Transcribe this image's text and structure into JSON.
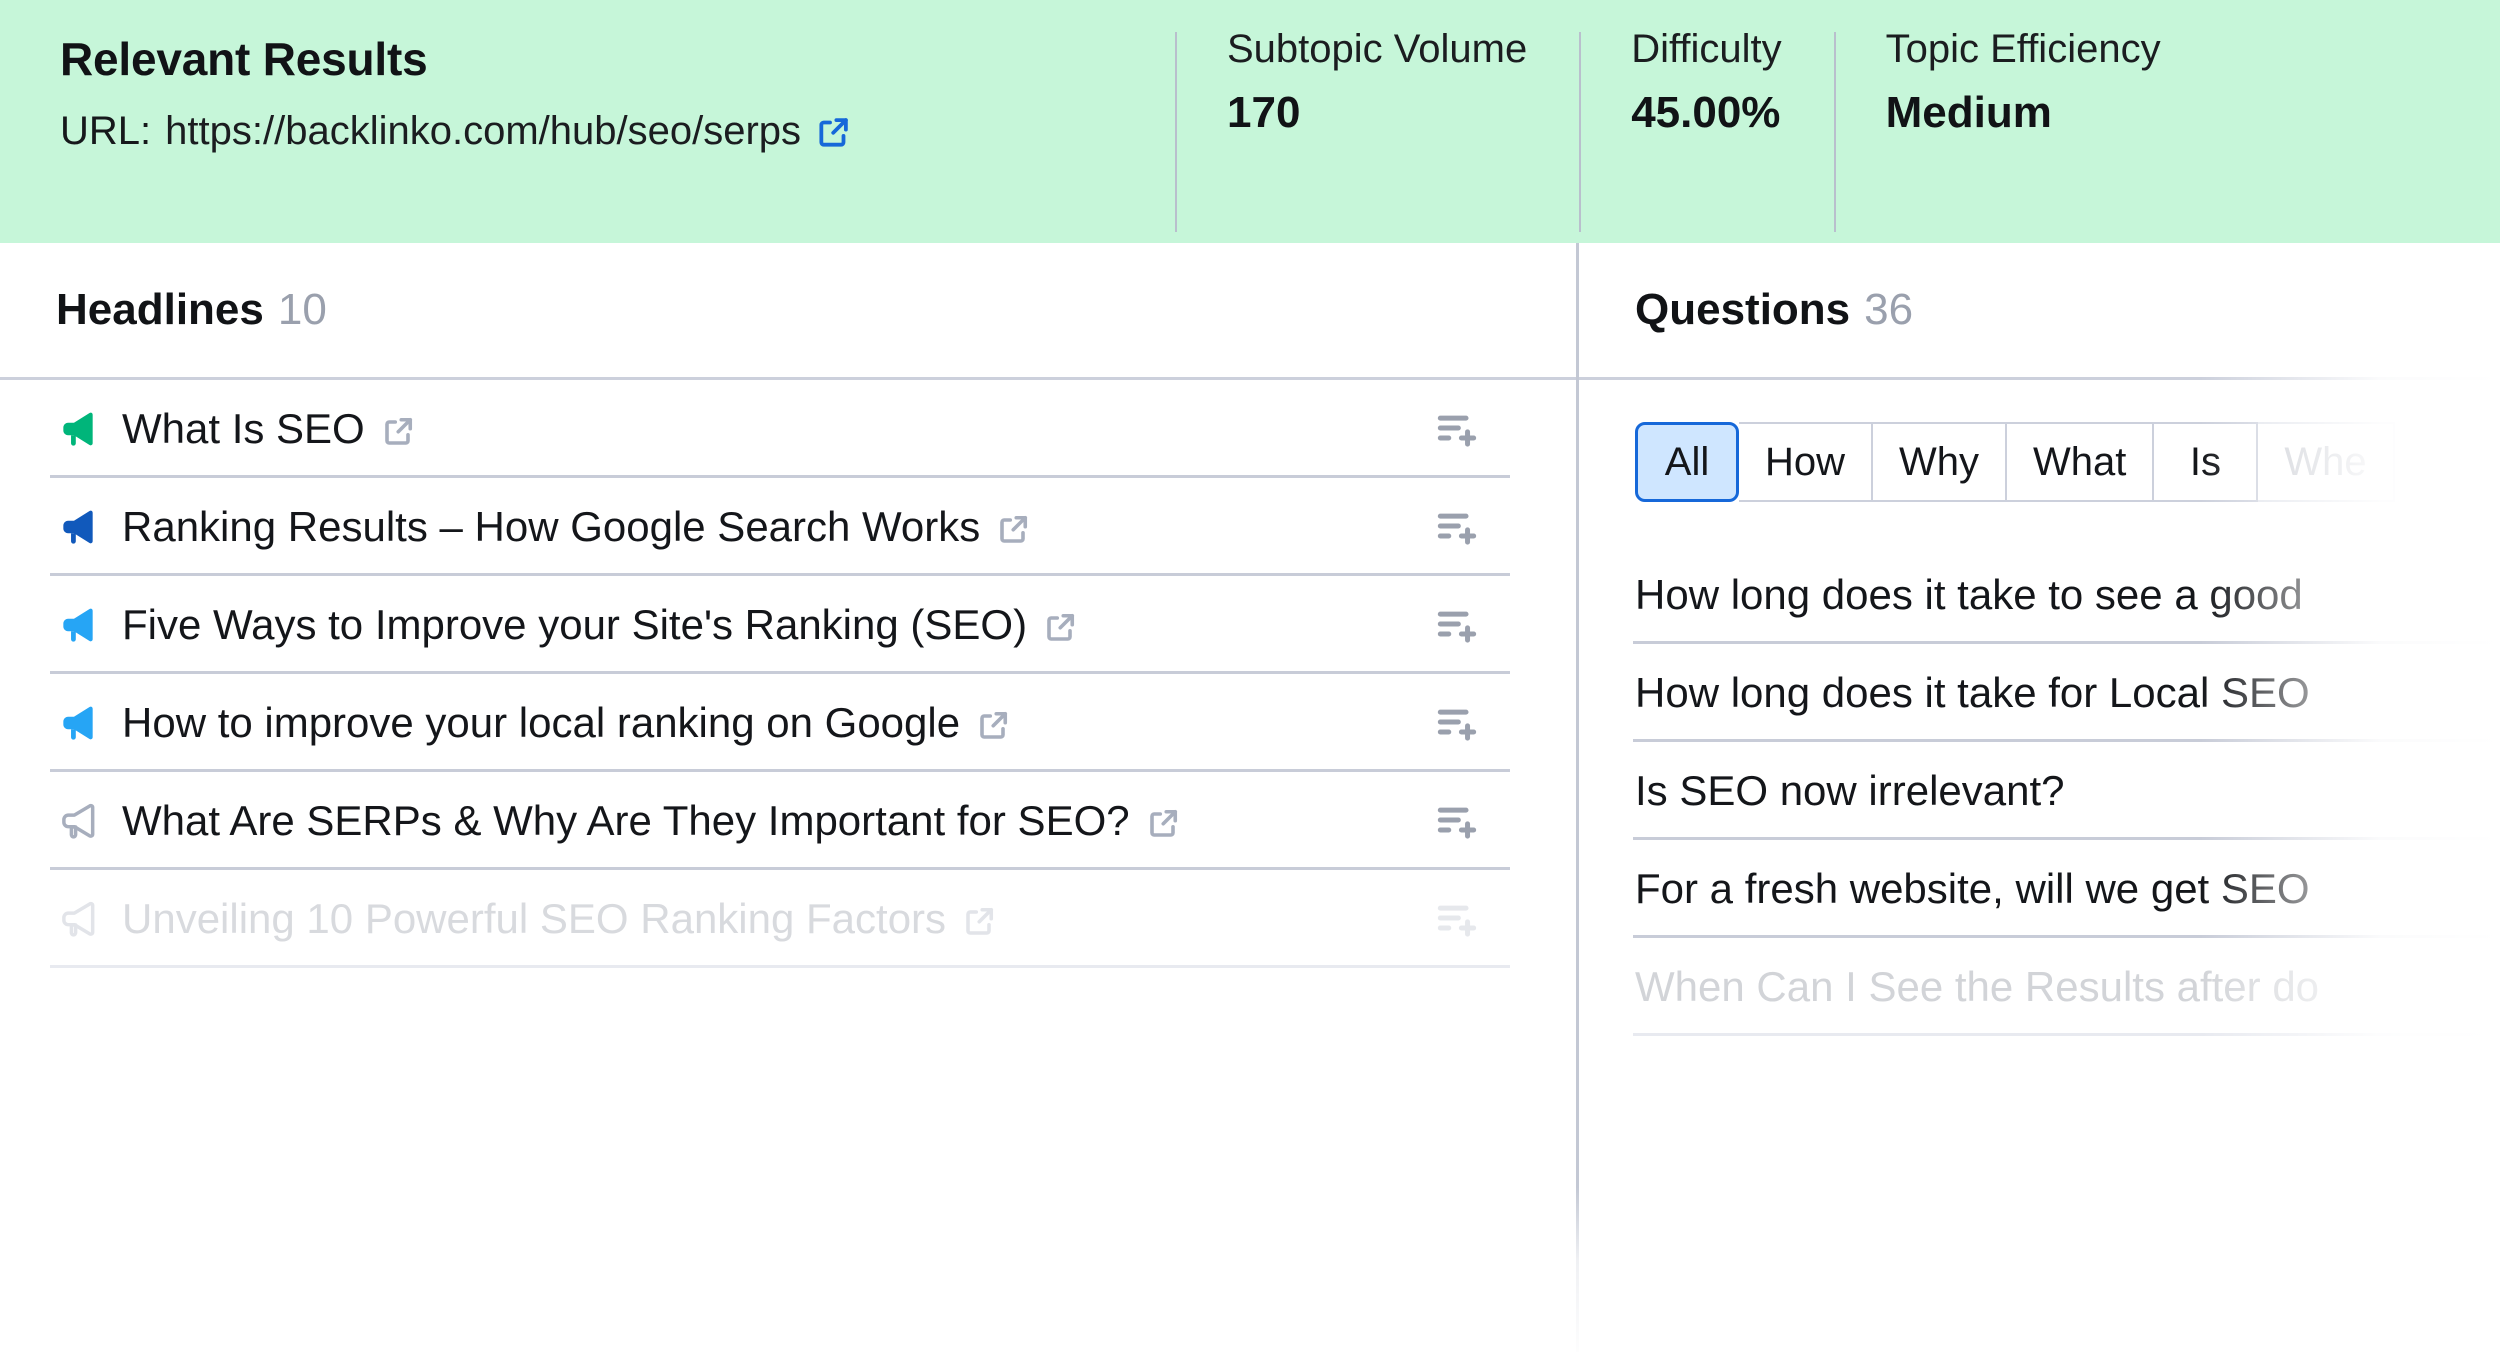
{
  "header": {
    "title": "Relevant Results",
    "url_label": "URL:",
    "url": "https://backlinko.com/hub/seo/serps",
    "url_icon": "external-link-icon",
    "metrics": [
      {
        "label": "Subtopic Volume",
        "value": "170"
      },
      {
        "label": "Difficulty",
        "value": "45.00%"
      },
      {
        "label": "Topic Efficiency",
        "value": "Medium"
      }
    ]
  },
  "headlines_panel": {
    "title": "Headlines",
    "count": "10",
    "add_icon": "add-to-list-icon",
    "items": [
      {
        "icon": "megaphone-icon",
        "icon_color": "#00b57a",
        "text": "What Is SEO",
        "link_icon": "external-link-icon",
        "faded": false
      },
      {
        "icon": "megaphone-icon",
        "icon_color": "#1159bb",
        "text": "Ranking Results – How Google Search Works",
        "link_icon": "external-link-icon",
        "faded": false
      },
      {
        "icon": "megaphone-icon",
        "icon_color": "#26a5f5",
        "text": "Five Ways to Improve your Site's Ranking (SEO)",
        "link_icon": "external-link-icon",
        "faded": false
      },
      {
        "icon": "megaphone-icon",
        "icon_color": "#26a5f5",
        "text": "How to improve your local ranking on Google",
        "link_icon": "external-link-icon",
        "faded": false
      },
      {
        "icon": "megaphone-icon",
        "icon_color": "#a7aebd",
        "text": "What Are SERPs & Why Are They Important for SEO?",
        "link_icon": "external-link-icon",
        "faded": false
      },
      {
        "icon": "megaphone-icon",
        "icon_color": "#e6e8ec",
        "text": "Unveiling 10 Powerful SEO Ranking Factors",
        "link_icon": "external-link-icon",
        "faded": true
      }
    ]
  },
  "questions_panel": {
    "title": "Questions",
    "count": "36",
    "tabs": [
      {
        "label": "All",
        "active": true,
        "dim": false
      },
      {
        "label": "How",
        "active": false,
        "dim": false
      },
      {
        "label": "Why",
        "active": false,
        "dim": false
      },
      {
        "label": "What",
        "active": false,
        "dim": false
      },
      {
        "label": "Is",
        "active": false,
        "dim": false
      },
      {
        "label": "Whe",
        "active": false,
        "dim": true
      }
    ],
    "items": [
      {
        "text": "How long does it take to see a good",
        "faded": false
      },
      {
        "text": "How long does it take for Local SEO",
        "faded": false
      },
      {
        "text": "Is SEO now irrelevant?",
        "faded": false
      },
      {
        "text": "For a fresh website, will we get SEO",
        "faded": false
      },
      {
        "text": "When Can I See the Results after do",
        "faded": true
      }
    ]
  },
  "colors": {
    "header_bg": "#c6f6d9",
    "accent_blue": "#1668d9",
    "tab_active_bg": "#cfe6ff",
    "divider": "#c8ccd8"
  }
}
